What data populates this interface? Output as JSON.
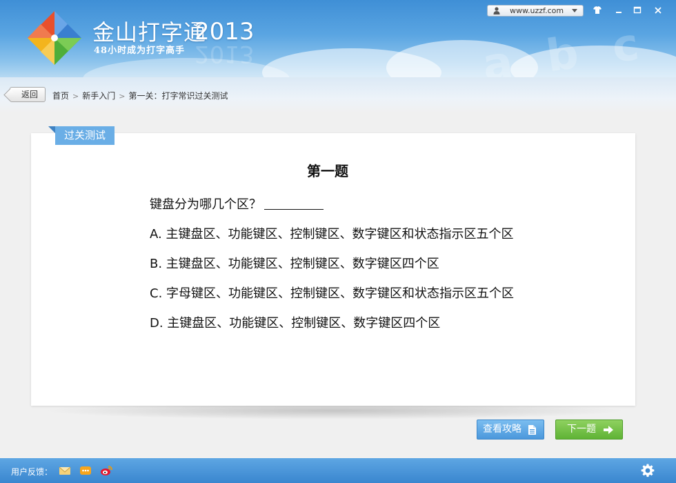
{
  "header": {
    "brand_title": "金山打字通",
    "brand_year": "2013",
    "slogan": "48小时成为打字高手",
    "url_text": "www.uzzf.com"
  },
  "nav": {
    "back_label": "返回",
    "breadcrumb": [
      "首页",
      "新手入门",
      "第一关：打字常识过关测试"
    ],
    "separator": ">"
  },
  "quiz": {
    "tab_label": "过关测试",
    "title": "第一题",
    "question": "键盘分为哪几个区？",
    "options": [
      "A. 主键盘区、功能键区、控制键区、数字键区和状态指示区五个区",
      "B. 主键盘区、功能键区、控制键区、数字键区四个区",
      "C. 字母键区、功能键区、控制键区、数字键区和状态指示区五个区",
      "D. 主键盘区、功能键区、控制键区、数字键区四个区"
    ]
  },
  "actions": {
    "guide_label": "查看攻略",
    "next_label": "下一题"
  },
  "footer": {
    "feedback_label": "用户反馈："
  },
  "icons": {
    "user": "user-icon",
    "skin": "shirt-icon",
    "minimize": "minimize-icon",
    "maximize": "maximize-icon",
    "close": "close-icon",
    "guide": "document-icon",
    "next": "arrow-right-icon",
    "email": "envelope-icon",
    "chat": "chat-icon",
    "weibo": "weibo-icon",
    "settings": "gear-icon"
  },
  "colors": {
    "header_blue": "#3f8fd6",
    "tab_blue": "#6aaee6",
    "guide_blue": "#4b98dc",
    "next_green": "#5fb335",
    "footer_blue": "#3a86cf"
  }
}
